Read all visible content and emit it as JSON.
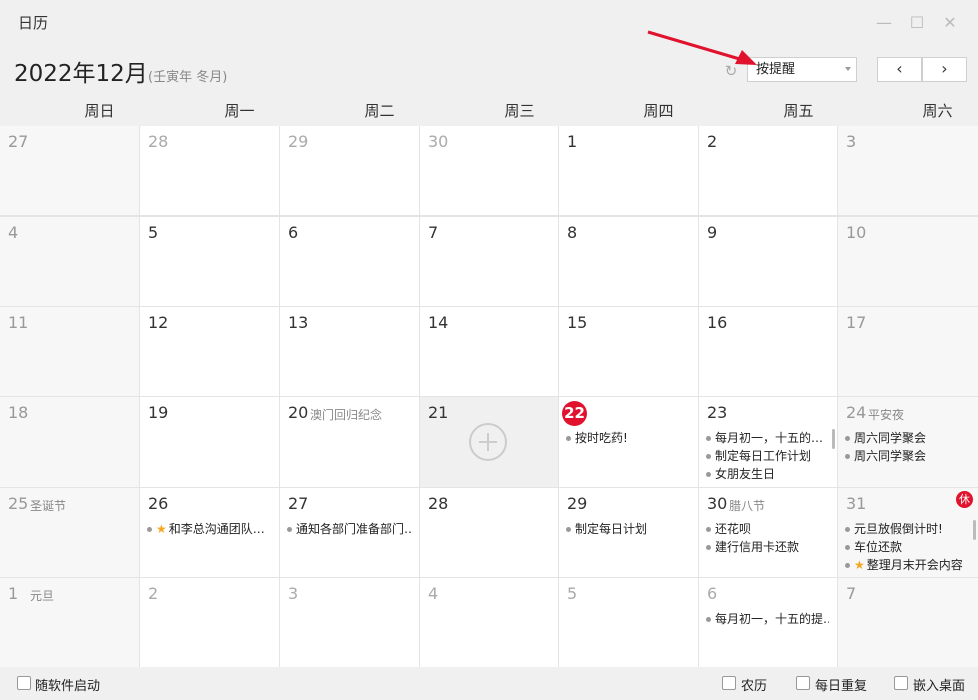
{
  "window": {
    "title": "日历",
    "minimize_glyph": "—",
    "maximize_glyph": "☐",
    "close_glyph": "✕"
  },
  "header": {
    "month_title": "2022年12月",
    "lunar_year": "(壬寅年 冬月)",
    "reminder_mode": "按提醒",
    "prev_glyph": "‹",
    "next_glyph": "›",
    "refresh_glyph": "↻"
  },
  "weekdays": [
    "周日",
    "周一",
    "周二",
    "周三",
    "周四",
    "周五",
    "周六"
  ],
  "weeks": [
    [
      {
        "day": "27",
        "festival": "",
        "events": []
      },
      {
        "day": "28",
        "festival": "",
        "events": []
      },
      {
        "day": "29",
        "festival": "",
        "events": []
      },
      {
        "day": "30",
        "festival": "",
        "events": []
      },
      {
        "day": "1",
        "festival": "",
        "events": []
      },
      {
        "day": "2",
        "festival": "",
        "events": []
      },
      {
        "day": "3",
        "festival": "",
        "events": []
      }
    ],
    [
      {
        "day": "4",
        "festival": "",
        "events": []
      },
      {
        "day": "5",
        "festival": "",
        "events": []
      },
      {
        "day": "6",
        "festival": "",
        "events": []
      },
      {
        "day": "7",
        "festival": "",
        "events": []
      },
      {
        "day": "8",
        "festival": "",
        "events": []
      },
      {
        "day": "9",
        "festival": "",
        "events": []
      },
      {
        "day": "10",
        "festival": "",
        "events": []
      }
    ],
    [
      {
        "day": "11",
        "festival": "",
        "events": []
      },
      {
        "day": "12",
        "festival": "",
        "events": []
      },
      {
        "day": "13",
        "festival": "",
        "events": []
      },
      {
        "day": "14",
        "festival": "",
        "events": []
      },
      {
        "day": "15",
        "festival": "",
        "events": []
      },
      {
        "day": "16",
        "festival": "",
        "events": []
      },
      {
        "day": "17",
        "festival": "",
        "events": []
      }
    ],
    [
      {
        "day": "18",
        "festival": "",
        "events": []
      },
      {
        "day": "19",
        "festival": "",
        "events": []
      },
      {
        "day": "20",
        "festival": "澳门回归纪念",
        "events": []
      },
      {
        "day": "21",
        "festival": "",
        "events": []
      },
      {
        "day": "22",
        "festival": "",
        "events": [
          "按时吃药!"
        ]
      },
      {
        "day": "23",
        "festival": "",
        "events": [
          "每月初一，十五的…",
          "制定每日工作计划",
          "女朋友生日"
        ]
      },
      {
        "day": "24",
        "festival": "平安夜",
        "events": [
          "周六同学聚会",
          "周六同学聚会"
        ]
      }
    ],
    [
      {
        "day": "25",
        "festival": "圣诞节",
        "events": []
      },
      {
        "day": "26",
        "festival": "",
        "events": [
          "和李总沟通团队…"
        ]
      },
      {
        "day": "27",
        "festival": "",
        "events": [
          "通知各部门准备部门…"
        ]
      },
      {
        "day": "28",
        "festival": "",
        "events": []
      },
      {
        "day": "29",
        "festival": "",
        "events": [
          "制定每日计划"
        ]
      },
      {
        "day": "30",
        "festival": "腊八节",
        "events": [
          "还花呗",
          "建行信用卡还款"
        ]
      },
      {
        "day": "31",
        "festival": "",
        "events": [
          "元旦放假倒计时!",
          "车位还款",
          "整理月末开会内容"
        ]
      }
    ],
    [
      {
        "day": "1",
        "festival": "元旦",
        "events": []
      },
      {
        "day": "2",
        "festival": "",
        "events": []
      },
      {
        "day": "3",
        "festival": "",
        "events": []
      },
      {
        "day": "4",
        "festival": "",
        "events": []
      },
      {
        "day": "5",
        "festival": "",
        "events": []
      },
      {
        "day": "6",
        "festival": "",
        "events": [
          "每月初一，十五的提…"
        ]
      },
      {
        "day": "7",
        "festival": "",
        "events": []
      }
    ]
  ],
  "rest_badge": "休",
  "footer": {
    "autostart_label": "随软件启动",
    "lunar_label": "农历",
    "daily_repeat_label": "每日重复",
    "embed_desktop_label": "嵌入桌面"
  },
  "colors": {
    "today": "#e0122e",
    "star": "#f5a623",
    "arrow": "#e0122e"
  }
}
